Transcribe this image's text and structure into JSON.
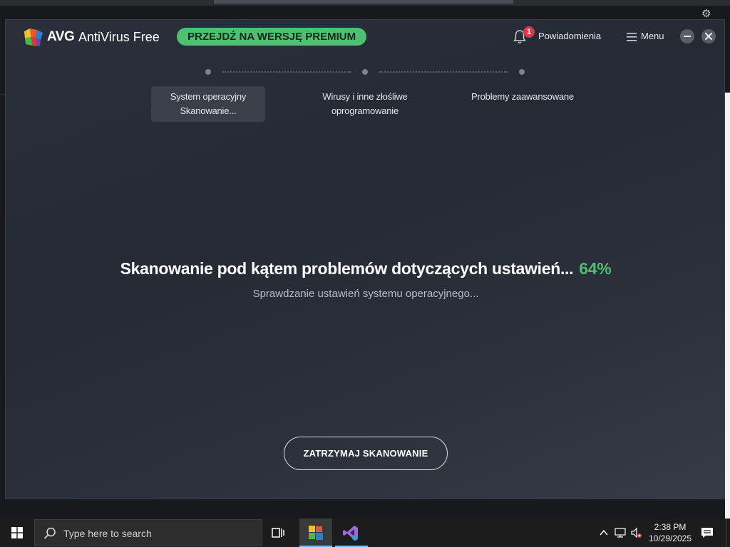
{
  "window": {
    "brand": "AVG",
    "product": "AntiVirus Free",
    "premium_button": "PRZEJDŹ NA WERSJĘ PREMIUM",
    "notifications_label": "Powiadomienia",
    "notifications_count": "1",
    "menu_label": "Menu"
  },
  "steps": [
    {
      "line1": "System operacyjny",
      "line2": "Skanowanie...",
      "active": true
    },
    {
      "line1": "Wirusy i inne złośliwe",
      "line2": "oprogramowanie",
      "active": false
    },
    {
      "line1": "Problemy zaawansowane",
      "line2": "",
      "active": false
    }
  ],
  "scan": {
    "title": "Skanowanie pod kątem problemów dotyczących ustawień...",
    "percent": "64%",
    "subtitle": "Sprawdzanie ustawień systemu operacyjnego...",
    "stop_button": "ZATRZYMAJ SKANOWANIE"
  },
  "taskbar": {
    "search_placeholder": "Type here to search",
    "time": "2:38 PM",
    "date": "10/29/2025"
  },
  "colors": {
    "accent_green": "#4fbf72",
    "badge_red": "#d33a4a"
  },
  "icons": [
    "gear-icon",
    "avg-logo-icon",
    "bell-icon",
    "hamburger-icon",
    "minimize-icon",
    "close-icon",
    "windows-start-icon",
    "search-icon",
    "task-view-icon",
    "avg-app-icon",
    "visual-studio-icon",
    "chevron-up-icon",
    "network-icon",
    "volume-muted-icon",
    "action-center-icon"
  ]
}
